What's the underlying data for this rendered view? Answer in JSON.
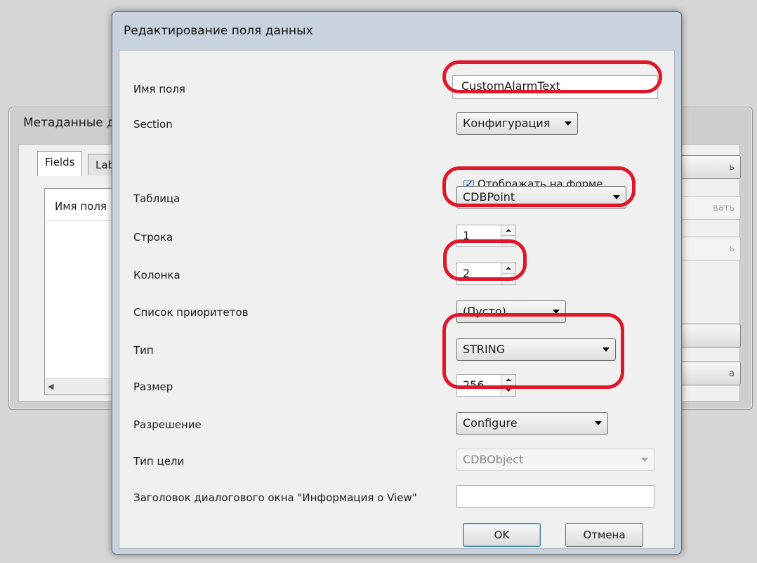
{
  "background_window": {
    "title": "Метаданные д",
    "tabs": [
      "Fields",
      "Lab"
    ],
    "list_header": "Имя поля",
    "buttons": [
      "ь",
      "вать",
      "ь",
      "",
      "а"
    ]
  },
  "dialog": {
    "title": "Редактирование поля данных",
    "fields": {
      "field_name": {
        "label": "Имя поля",
        "value": "CustomAlarmText"
      },
      "section": {
        "label": "Section",
        "value": "Конфигурация"
      },
      "show_on_form": {
        "label": "Отображать на форме",
        "checked": true
      },
      "table": {
        "label": "Таблица",
        "value": "CDBPoint"
      },
      "row": {
        "label": "Строка",
        "value": "1"
      },
      "column": {
        "label": "Колонка",
        "value": "2"
      },
      "priority_list": {
        "label": "Список приоритетов",
        "value": "(Пусто)"
      },
      "type": {
        "label": "Тип",
        "value": "STRING"
      },
      "size": {
        "label": "Размер",
        "value": "256"
      },
      "permission": {
        "label": "Разрешение",
        "value": "Configure"
      },
      "target_type": {
        "label": "Тип цели",
        "value": "CDBObject"
      },
      "view_dialog_title": {
        "label": "Заголовок диалогового окна \"Информация о View\"",
        "value": ""
      }
    },
    "ok_label": "OK",
    "cancel_label": "Отмена"
  },
  "colors": {
    "highlight": "#e0162b",
    "dialog_frame": "#c9d3de",
    "panel": "#f0f0f0"
  }
}
